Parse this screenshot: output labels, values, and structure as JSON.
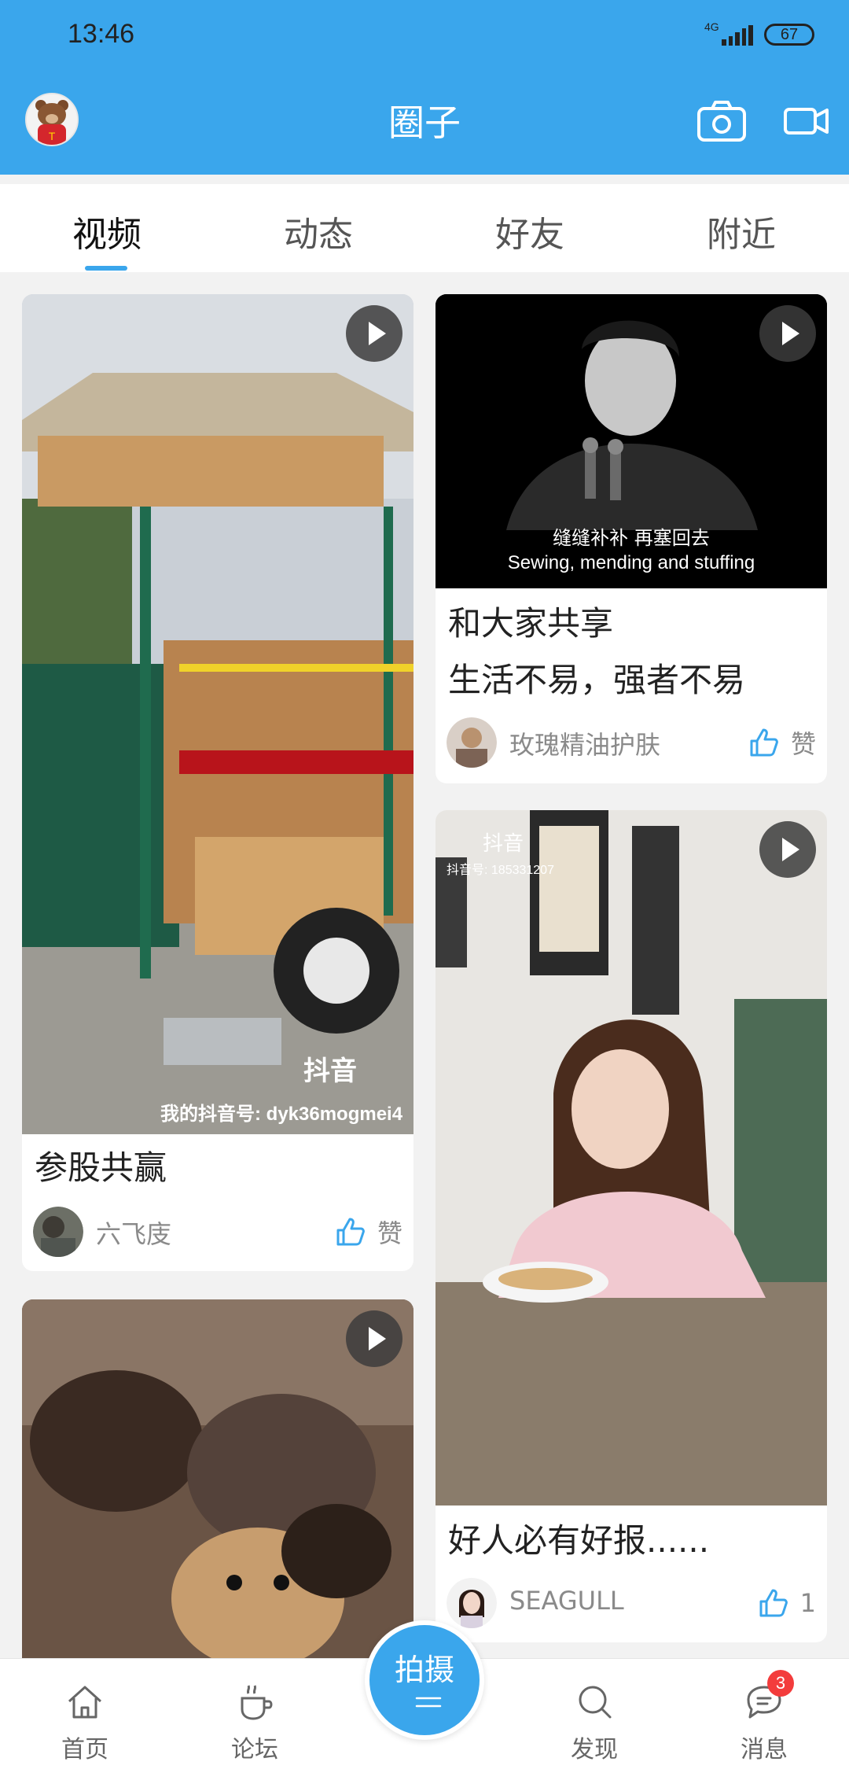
{
  "status_bar": {
    "time": "13:46",
    "network": "4G",
    "battery": "67"
  },
  "header": {
    "title": "圈子",
    "camera_icon": "camera-icon",
    "video_icon": "video-camera-icon"
  },
  "tabs": [
    {
      "label": "视频",
      "active": true
    },
    {
      "label": "动态"
    },
    {
      "label": "好友"
    },
    {
      "label": "附近"
    }
  ],
  "feed": {
    "card1": {
      "title": "参股共赢",
      "user": "六飞庋",
      "like_label": "赞",
      "overlay_brand": "抖音",
      "overlay_id": "我的抖音号: dyk36mogmei4"
    },
    "card2": {
      "caption_cn": "缝缝补补 再塞回去",
      "caption_en": "Sewing, mending and stuffing",
      "title_line1": "和大家共享",
      "title_line2": "生活不易，强者不易",
      "user": "玫瑰精油护肤",
      "like_label": "赞"
    },
    "card3": {
      "overlay_brand": "抖音",
      "overlay_id": "抖音号: 185331207",
      "title": "好人必有好报......",
      "user": "SEAGULL",
      "like_count": "1"
    },
    "card4": {}
  },
  "bottom_nav": {
    "home": "首页",
    "forum": "论坛",
    "shoot": "拍摄",
    "discover": "发现",
    "messages": "消息",
    "messages_badge": "3"
  },
  "colors": {
    "accent": "#3aa6ec",
    "badge": "#f33c3c"
  }
}
